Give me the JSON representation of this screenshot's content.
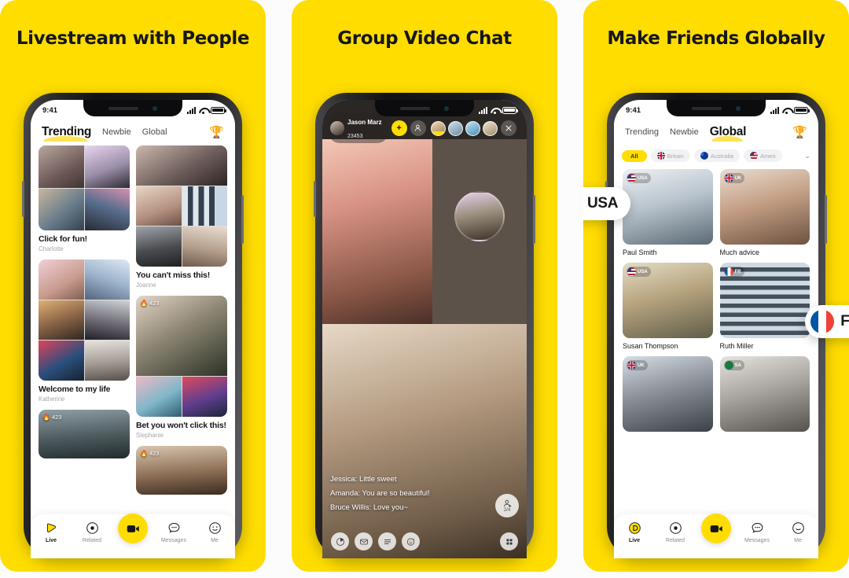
{
  "page": {
    "background": "#fcfcfc",
    "accent_yellow": "#FFDD00",
    "text_dark": "#17161a"
  },
  "panels": [
    {
      "id": "panel-livestream",
      "title": "Livestream with People",
      "screen": {
        "status_bar": {
          "time": "9:41",
          "signal_icon": "signal-bars-icon",
          "wifi_icon": "wifi-icon",
          "battery_icon": "battery-icon"
        },
        "tabs": [
          {
            "label": "Trending",
            "active": true
          },
          {
            "label": "Newbie",
            "active": false
          },
          {
            "label": "Global",
            "active": false
          }
        ],
        "trophy_icon": "trophy-icon",
        "feed": {
          "left_column": [
            {
              "title": "Click for fun!",
              "author": "Charlotte",
              "layout": "grid-2x2",
              "badge": null
            },
            {
              "title": "Welcome to my life",
              "author": "Katherine",
              "layout": "grid-2x3",
              "badge": null
            },
            {
              "title": "",
              "author": "",
              "layout": "single",
              "badge": {
                "icon": "flame-icon",
                "count": "423"
              }
            }
          ],
          "right_column": [
            {
              "title": "You can't miss this!",
              "author": "Joanne",
              "layout": "grid-2x3",
              "badge": null
            },
            {
              "title": "Bet you won't click this!",
              "author": "Stephanie",
              "layout": "grid-2x3",
              "badge": {
                "icon": "flame-icon",
                "count": "423"
              }
            },
            {
              "title": "",
              "author": "",
              "layout": "single",
              "badge": {
                "icon": "flame-icon",
                "count": "423"
              }
            }
          ]
        },
        "tabbar": [
          {
            "label": "Live",
            "icon": "live-play-icon",
            "active": true
          },
          {
            "label": "Related",
            "icon": "target-circle-icon",
            "active": false
          },
          {
            "label": "",
            "icon": "video-camera-icon",
            "active": false,
            "center": true
          },
          {
            "label": "Messages",
            "icon": "chat-bubble-icon",
            "active": false
          },
          {
            "label": "Me",
            "icon": "smiley-face-icon",
            "active": false
          }
        ]
      }
    },
    {
      "id": "panel-groupchat",
      "title": "Group Video Chat",
      "screen": {
        "status_bar": {
          "time": "",
          "signal_icon": "signal-bars-icon",
          "wifi_icon": "wifi-icon",
          "battery_icon": "battery-icon"
        },
        "host": {
          "name": "Jason Marz",
          "id": "23453",
          "avatar": "host-avatar"
        },
        "add_button_label": "+",
        "invite_icon": "person-add-icon",
        "close_icon": "close-icon",
        "participants": [
          {
            "name": "participant-1",
            "speaking": true
          },
          {
            "name": "participant-2",
            "speaking": false
          },
          {
            "name": "participant-3",
            "speaking": false
          },
          {
            "name": "participant-4",
            "speaking": false
          }
        ],
        "chat_lines": [
          "Jessica: Little sweet",
          "Amanda: You are so beautiful!",
          "Bruce Willis: Love you~"
        ],
        "seats_badge": {
          "icon": "seat-person-icon",
          "count": "2/4"
        },
        "tools": [
          {
            "icon": "pie-chart-icon",
            "name": "stats-tool"
          },
          {
            "icon": "mail-icon",
            "name": "mail-tool"
          },
          {
            "icon": "list-icon",
            "name": "list-tool"
          },
          {
            "icon": "sticker-smiley-icon",
            "name": "sticker-tool"
          },
          {
            "icon": "grid-apps-icon",
            "name": "apps-tool"
          }
        ]
      }
    },
    {
      "id": "panel-global",
      "title": "Make Friends Globally",
      "screen": {
        "status_bar": {
          "time": "9:41",
          "signal_icon": "signal-bars-icon",
          "wifi_icon": "wifi-icon",
          "battery_icon": "battery-icon"
        },
        "tabs": [
          {
            "label": "Trending",
            "active": false
          },
          {
            "label": "Newbie",
            "active": false
          },
          {
            "label": "Global",
            "active": true
          }
        ],
        "trophy_icon": "trophy-icon",
        "chips": [
          {
            "label": "All",
            "flag": "none",
            "active": true
          },
          {
            "label": "Britain",
            "flag": "uk",
            "active": false
          },
          {
            "label": "Australia",
            "flag": "au",
            "active": false
          },
          {
            "label": "Ameri",
            "flag": "us",
            "active": false
          }
        ],
        "chevron_icon": "chevron-down-icon",
        "cards": [
          {
            "name": "Paul Smith",
            "flag": "us",
            "flag_label": "USA"
          },
          {
            "name": "Much advice",
            "flag": "uk",
            "flag_label": "UK"
          },
          {
            "name": "Susan Thompson",
            "flag": "us",
            "flag_label": "USA"
          },
          {
            "name": "Ruth Miller",
            "flag": "fr",
            "flag_label": "FR"
          },
          {
            "name": "",
            "flag": "uk",
            "flag_label": "UK"
          },
          {
            "name": "",
            "flag": "sa",
            "flag_label": "SA"
          }
        ],
        "callouts": [
          {
            "label": "USA",
            "flag": "us"
          },
          {
            "label": "FR",
            "flag": "fr"
          }
        ],
        "tabbar": [
          {
            "label": "Live",
            "icon": "live-play-icon",
            "active": true
          },
          {
            "label": "Related",
            "icon": "target-circle-icon",
            "active": false
          },
          {
            "label": "",
            "icon": "video-camera-icon",
            "active": false,
            "center": true
          },
          {
            "label": "Messages",
            "icon": "chat-bubble-icon",
            "active": false
          },
          {
            "label": "Me",
            "icon": "smiley-face-icon",
            "active": false
          }
        ]
      }
    }
  ]
}
